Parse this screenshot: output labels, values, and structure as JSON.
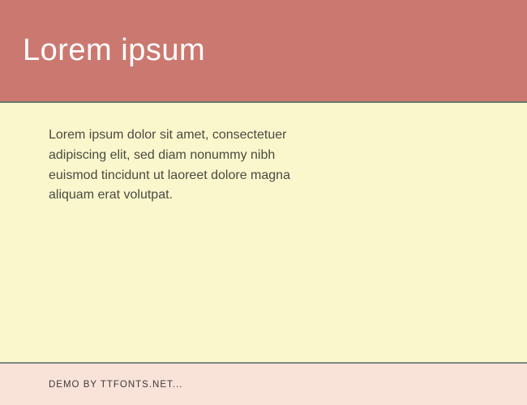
{
  "header": {
    "title": "Lorem ipsum"
  },
  "content": {
    "body_text": "Lorem ipsum dolor sit amet, consectetuer adipiscing elit, sed diam nonummy nibh euismod tincidunt ut laoreet dolore magna aliquam erat volutpat."
  },
  "footer": {
    "credit": "DEMO BY TTFONTS.NET..."
  }
}
